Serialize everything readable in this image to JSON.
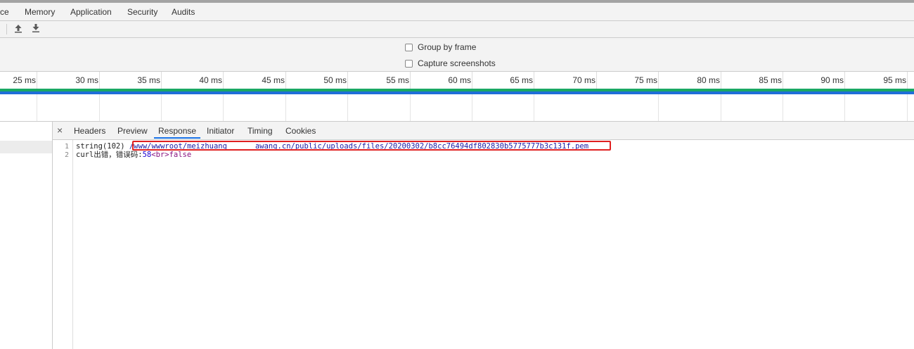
{
  "devtools_tabs": [
    "ce",
    "Memory",
    "Application",
    "Security",
    "Audits"
  ],
  "toolbar": {
    "upload_icon": "upload-arrow-icon",
    "download_icon": "download-arrow-icon"
  },
  "settings": {
    "group_by_frame": {
      "label": "Group by frame",
      "checked": false
    },
    "capture_screenshots": {
      "label": "Capture screenshots",
      "checked": false
    }
  },
  "ruler_ticks": [
    "25 ms",
    "30 ms",
    "35 ms",
    "40 ms",
    "45 ms",
    "50 ms",
    "55 ms",
    "60 ms",
    "65 ms",
    "70 ms",
    "75 ms",
    "80 ms",
    "85 ms",
    "90 ms",
    "95 ms"
  ],
  "detail_tabs": {
    "close": "×",
    "items": [
      "Headers",
      "Preview",
      "Response",
      "Initiator",
      "Timing",
      "Cookies"
    ],
    "active": "Response"
  },
  "response": {
    "line1_no": "1",
    "line1_prefix": "string(102) ",
    "line1_path_a": "/www/wwwroot/meizhuang",
    "line1_path_b": "awang.cn/public/uploads/files/20200302/b8cc76494df802830b5775777b3c131f.pem",
    "line2_no": "2",
    "line2_text": "curl出错，错误码:",
    "line2_code": "58",
    "line2_tag": "<br>",
    "line2_value": "false"
  },
  "colors": {
    "highlight_box": "#e02020",
    "active_tab_underline": "#1a73e8"
  }
}
